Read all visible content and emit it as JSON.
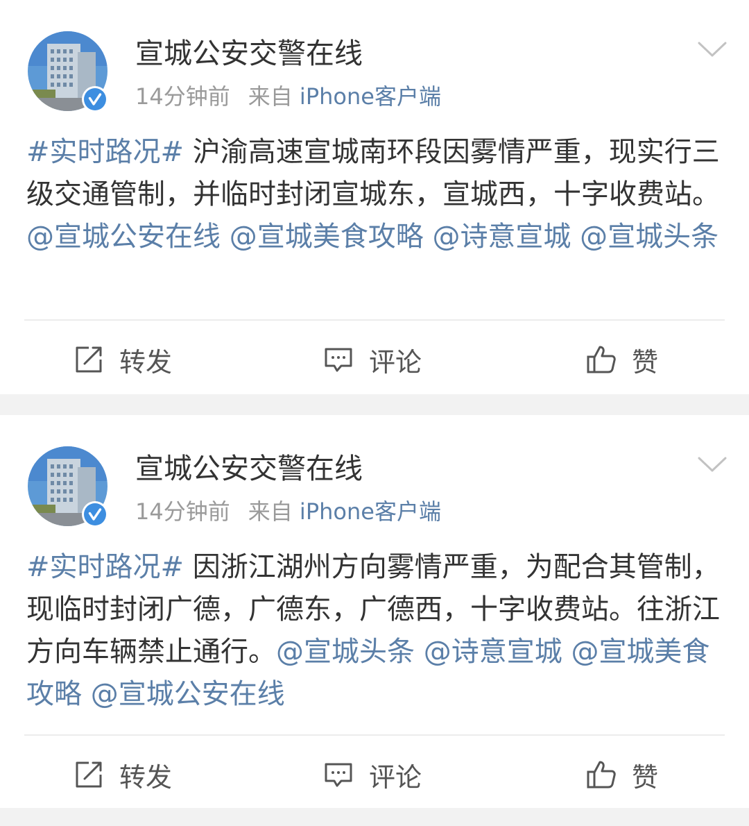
{
  "posts": [
    {
      "author": "宣城公安交警在线",
      "time": "14分钟前",
      "source_prefix": "来自",
      "source": "iPhone客户端",
      "text": {
        "topic": "#实时路况#",
        "body": " 沪渝高速宣城南环段因雾情严重，现实行三级交通管制，并临时封闭宣城东，宣城西，十字收费站。",
        "mentions": [
          "@宣城公安在线",
          "@宣城美食攻略",
          "@诗意宣城",
          "@宣城头条"
        ]
      },
      "actions": {
        "repost": "转发",
        "comment": "评论",
        "like": "赞"
      }
    },
    {
      "author": "宣城公安交警在线",
      "time": "14分钟前",
      "source_prefix": "来自",
      "source": "iPhone客户端",
      "text": {
        "topic": "#实时路况#",
        "body": " 因浙江湖州方向雾情严重，为配合其管制，现临时封闭广德，广德东，广德西，十字收费站。往浙江方向车辆禁止通行。",
        "mentions": [
          "@宣城头条",
          "@诗意宣城",
          "@宣城美食攻略",
          "@宣城公安在线"
        ]
      },
      "actions": {
        "repost": "转发",
        "comment": "评论",
        "like": "赞"
      }
    }
  ],
  "icons": {
    "verified": "verified-badge-icon",
    "more": "chevron-down-icon",
    "repost": "repost-icon",
    "comment": "comment-icon",
    "like": "thumbs-up-icon"
  },
  "colors": {
    "link": "#5b7fa8",
    "text": "#333333",
    "meta": "#9a9a9a",
    "verified": "#3d8ee0",
    "background": "#f2f2f2"
  }
}
